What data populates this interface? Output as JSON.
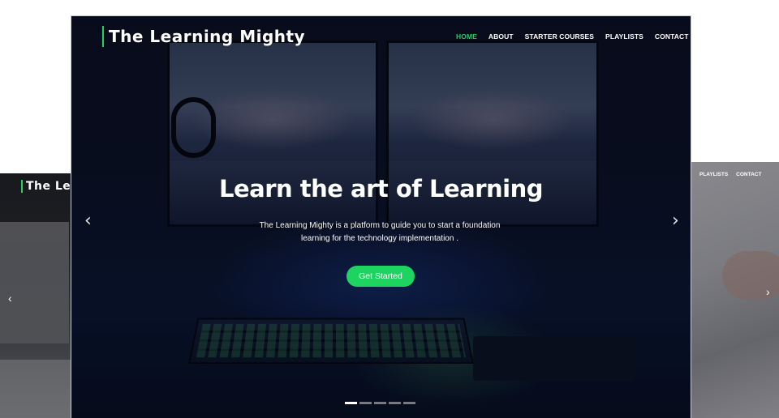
{
  "brand": "The Learning Mighty",
  "nav": {
    "items": [
      "HOME",
      "ABOUT",
      "STARTER COURSES",
      "PLAYLISTS",
      "CONTACT"
    ],
    "active": "HOME"
  },
  "hero": {
    "headline": "Learn the art of Learning",
    "subtext": "The Learning Mighty is a platform to guide you to start a foundation learning for the technology implementation .",
    "cta_label": "Get Started",
    "prev_icon": "chevron-left-icon",
    "next_icon": "chevron-right-icon"
  },
  "carousel": {
    "slide_count": 5,
    "active_index": 0
  },
  "mock_left": {
    "brand_partial": "The Lea"
  },
  "mock_right": {
    "nav_items": [
      "PLAYLISTS",
      "CONTACT"
    ]
  },
  "colors": {
    "accent": "#1dd460",
    "hero_bg": "#0a0d1c",
    "text": "#ffffff"
  }
}
